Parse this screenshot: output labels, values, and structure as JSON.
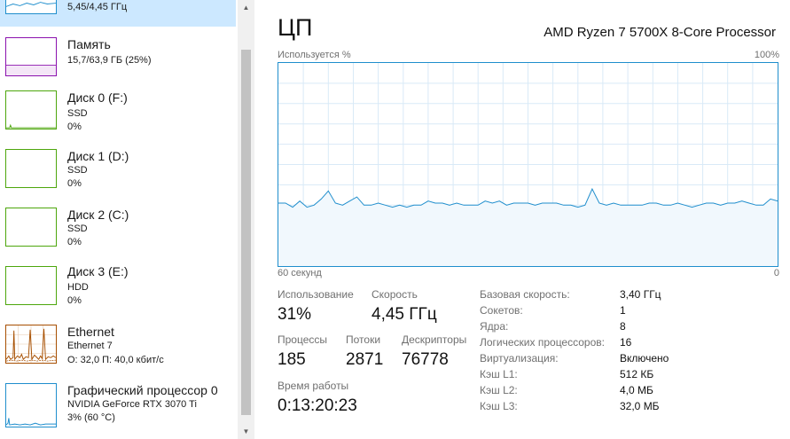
{
  "sidebar": {
    "items": [
      {
        "title": "",
        "lines": [
          "",
          "",
          ""
        ]
      },
      {
        "title": "Память",
        "lines": [
          "15,7/63,9 ГБ (25%)"
        ]
      },
      {
        "title": "Диск 0 (F:)",
        "lines": [
          "SSD",
          "0%"
        ]
      },
      {
        "title": "Диск 1 (D:)",
        "lines": [
          "SSD",
          "0%"
        ]
      },
      {
        "title": "Диск 2 (C:)",
        "lines": [
          "SSD",
          "0%"
        ]
      },
      {
        "title": "Диск 3 (E:)",
        "lines": [
          "HDD",
          "0%"
        ]
      },
      {
        "title": "Ethernet",
        "lines": [
          "Ethernet 7",
          "О: 32,0 П: 40,0 кбит/с"
        ]
      },
      {
        "title": "Графический процессор 0",
        "lines": [
          "NVIDIA GeForce RTX 3070 Ti",
          "3% (60 °C)"
        ]
      }
    ],
    "first_item_partial": "5,45/4,45 ГГц"
  },
  "scrollbar": {
    "up_icon": "▲",
    "down_icon": "▼"
  },
  "colors": {
    "cpu": "#1f8ecd",
    "memory": "#8b12ae",
    "disk": "#4da60c",
    "ethernet": "#a74f01",
    "gpu": "#1f8ecd",
    "selected": "#cce8ff"
  },
  "main": {
    "title": "ЦП",
    "processor": "AMD Ryzen 7 5700X 8-Core Processor",
    "graph": {
      "y_label": "Используется %",
      "y_max_label": "100%",
      "x_left_label": "60 секунд",
      "x_right_label": "0"
    },
    "stats": {
      "utilization_label": "Использование",
      "utilization_value": "31%",
      "speed_label": "Скорость",
      "speed_value": "4,45 ГГц",
      "processes_label": "Процессы",
      "processes_value": "185",
      "threads_label": "Потоки",
      "threads_value": "2871",
      "handles_label": "Дескрипторы",
      "handles_value": "76778",
      "uptime_label": "Время работы",
      "uptime_value": "0:13:20:23"
    },
    "details": [
      {
        "label": "Базовая скорость:",
        "value": "3,40 ГГц"
      },
      {
        "label": "Сокетов:",
        "value": "1"
      },
      {
        "label": "Ядра:",
        "value": "8"
      },
      {
        "label": "Логических процессоров:",
        "value": "16"
      },
      {
        "label": "Виртуализация:",
        "value": "Включено"
      },
      {
        "label": "Кэш L1:",
        "value": "512 КБ"
      },
      {
        "label": "Кэш L2:",
        "value": "4,0 МБ"
      },
      {
        "label": "Кэш L3:",
        "value": "32,0 МБ"
      }
    ]
  },
  "chart_data": {
    "type": "area",
    "y_label": "Используется %",
    "ylim": [
      0,
      100
    ],
    "x_left_label": "60 секунд",
    "x_right_label": "0",
    "grid": true,
    "values": [
      31,
      31,
      29,
      32,
      29,
      30,
      33,
      37,
      31,
      30,
      32,
      34,
      30,
      30,
      31,
      30,
      29,
      30,
      29,
      30,
      30,
      32,
      31,
      31,
      30,
      31,
      30,
      30,
      30,
      32,
      31,
      32,
      30,
      31,
      31,
      31,
      30,
      31,
      31,
      31,
      30,
      30,
      29,
      30,
      38,
      31,
      30,
      31,
      30,
      30,
      30,
      30,
      31,
      31,
      30,
      30,
      31,
      30,
      29,
      30,
      31,
      31,
      30,
      31,
      31,
      32,
      31,
      30,
      30,
      33,
      32
    ]
  }
}
